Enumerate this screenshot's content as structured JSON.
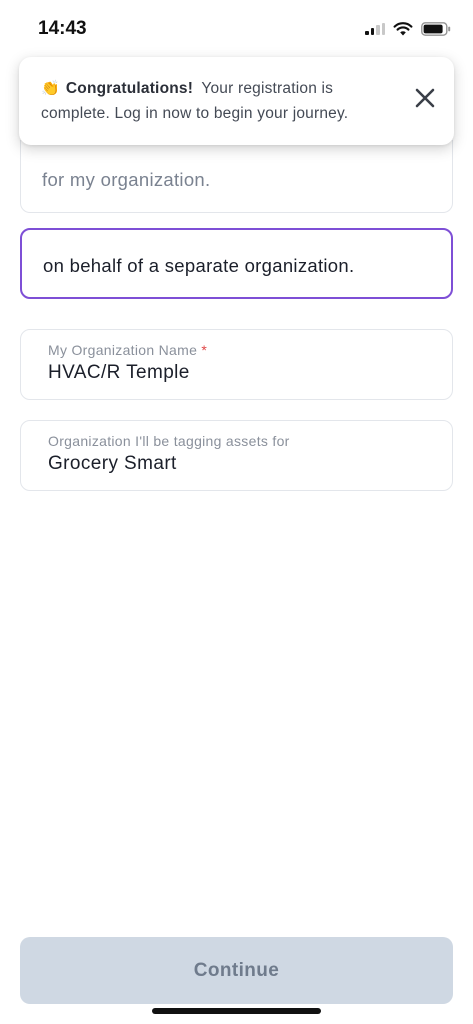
{
  "status_bar": {
    "time": "14:43",
    "icons": [
      "cellular-signal-icon",
      "wifi-icon",
      "battery-icon"
    ]
  },
  "toast": {
    "emoji": "👏",
    "title": "Congratulations!",
    "message": "Your registration is complete. Log in now to begin your journey.",
    "close_icon": "close-icon"
  },
  "options": [
    {
      "label": "for my organization."
    },
    {
      "label": "on behalf of a separate organization.",
      "selected": true
    }
  ],
  "fields": {
    "my_org": {
      "label": "My Organization Name",
      "required_marker": "*",
      "value": "HVAC/R Temple"
    },
    "tagging_org": {
      "label": "Organization I'll be tagging assets for",
      "value": "Grocery Smart"
    }
  },
  "actions": {
    "continue_label": "Continue"
  },
  "colors": {
    "accent": "#7e4fd6",
    "required": "#e04646",
    "button_disabled_bg": "#cfd8e3",
    "button_disabled_text": "#6f7b8c"
  }
}
